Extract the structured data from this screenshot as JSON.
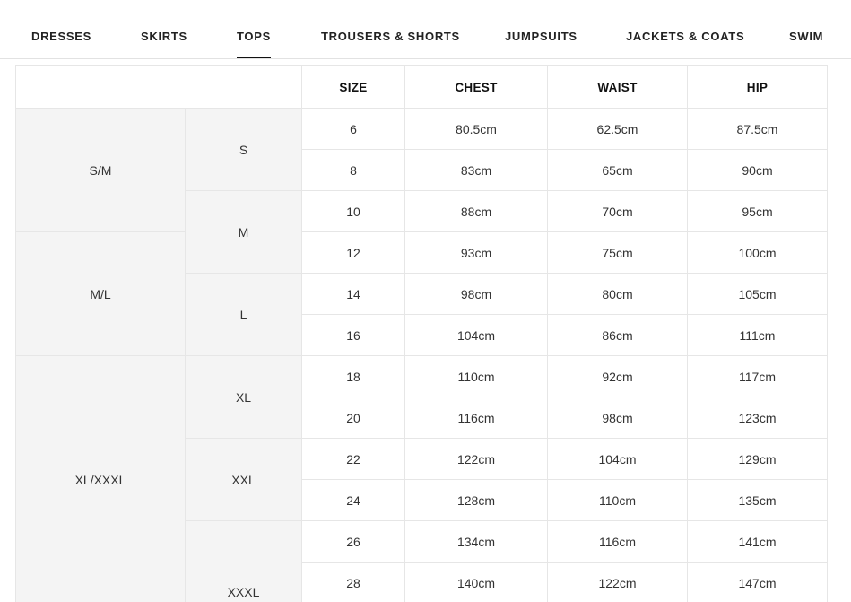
{
  "nav": {
    "tabs": [
      {
        "label": "DRESSES"
      },
      {
        "label": "SKIRTS"
      },
      {
        "label": "TOPS"
      },
      {
        "label": "TROUSERS & SHORTS"
      },
      {
        "label": "JUMPSUITS"
      },
      {
        "label": "JACKETS & COATS"
      },
      {
        "label": "SWIM"
      }
    ],
    "active_tab": "TOPS"
  },
  "table": {
    "headers": {
      "size": "SIZE",
      "chest": "CHEST",
      "waist": "WAIST",
      "hip": "HIP"
    },
    "groups": [
      "S/M",
      "M/L",
      "XL/XXXL"
    ],
    "subgroups": [
      "S",
      "M",
      "L",
      "XL",
      "XXL",
      "XXXL"
    ],
    "rows": [
      {
        "size": "6",
        "chest": "80.5cm",
        "waist": "62.5cm",
        "hip": "87.5cm"
      },
      {
        "size": "8",
        "chest": "83cm",
        "waist": "65cm",
        "hip": "90cm"
      },
      {
        "size": "10",
        "chest": "88cm",
        "waist": "70cm",
        "hip": "95cm"
      },
      {
        "size": "12",
        "chest": "93cm",
        "waist": "75cm",
        "hip": "100cm"
      },
      {
        "size": "14",
        "chest": "98cm",
        "waist": "80cm",
        "hip": "105cm"
      },
      {
        "size": "16",
        "chest": "104cm",
        "waist": "86cm",
        "hip": "111cm"
      },
      {
        "size": "18",
        "chest": "110cm",
        "waist": "92cm",
        "hip": "117cm"
      },
      {
        "size": "20",
        "chest": "116cm",
        "waist": "98cm",
        "hip": "123cm"
      },
      {
        "size": "22",
        "chest": "122cm",
        "waist": "104cm",
        "hip": "129cm"
      },
      {
        "size": "24",
        "chest": "128cm",
        "waist": "110cm",
        "hip": "135cm"
      },
      {
        "size": "26",
        "chest": "134cm",
        "waist": "116cm",
        "hip": "141cm"
      },
      {
        "size": "28",
        "chest": "140cm",
        "waist": "122cm",
        "hip": "147cm"
      }
    ]
  },
  "colors": {
    "accent": "#111111",
    "group_bg": "#f4f4f4",
    "border": "#e6e6e6"
  }
}
